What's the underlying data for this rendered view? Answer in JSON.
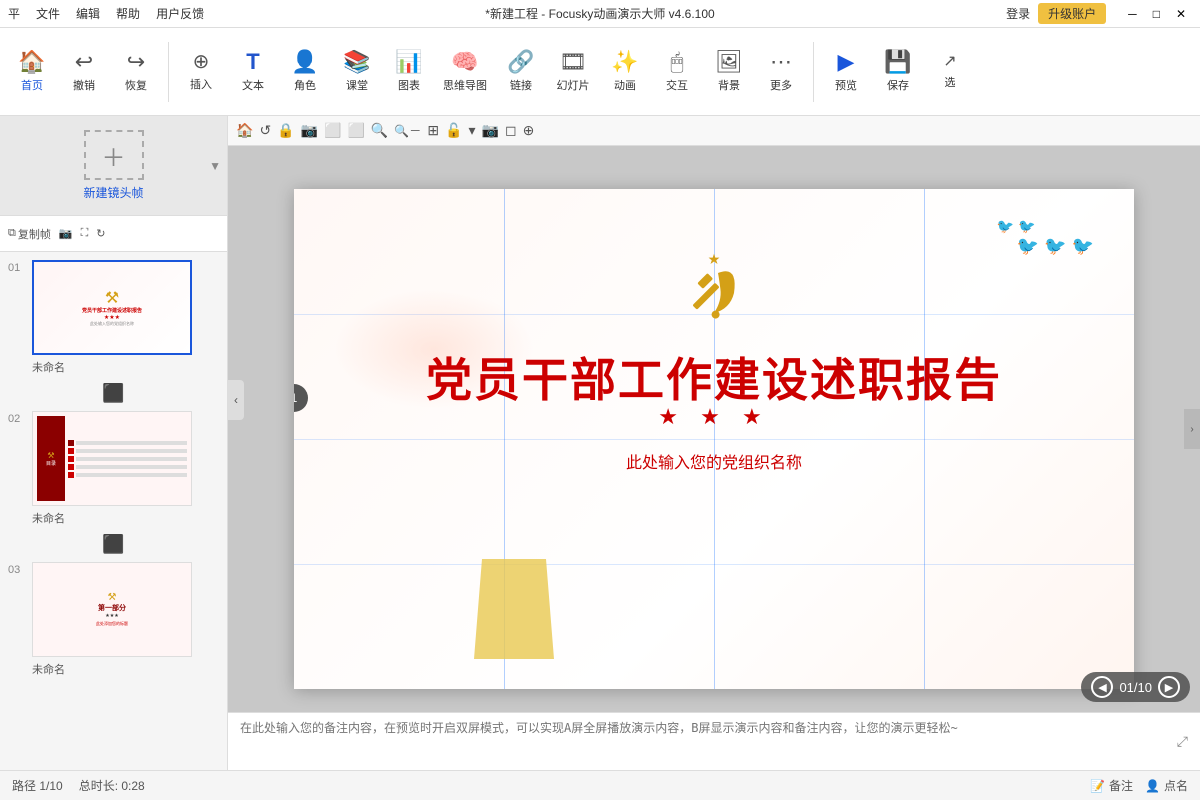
{
  "titlebar": {
    "menu": [
      "平",
      "文件",
      "编辑",
      "帮助",
      "用户反馈"
    ],
    "title": "*新建工程 - Focusky动画演示大师  v4.6.100",
    "login": "登录",
    "upgrade": "升级账户",
    "win_min": "─",
    "win_max": "□",
    "win_close": "✕"
  },
  "toolbar": {
    "items": [
      {
        "label": "首页",
        "icon": "🏠"
      },
      {
        "label": "撤销",
        "icon": "↩"
      },
      {
        "label": "恢复",
        "icon": "↪"
      },
      {
        "label": "插入",
        "icon": "➕"
      },
      {
        "label": "文本",
        "icon": "T"
      },
      {
        "label": "角色",
        "icon": "👤"
      },
      {
        "label": "课堂",
        "icon": "🎓"
      },
      {
        "label": "图表",
        "icon": "📊"
      },
      {
        "label": "思维导图",
        "icon": "🧠"
      },
      {
        "label": "链接",
        "icon": "🔗"
      },
      {
        "label": "幻灯片",
        "icon": "🎞"
      },
      {
        "label": "动画",
        "icon": "✨"
      },
      {
        "label": "交互",
        "icon": "🖱"
      },
      {
        "label": "背景",
        "icon": "🖼"
      },
      {
        "label": "更多",
        "icon": "⋯"
      },
      {
        "label": "预览",
        "icon": "▶"
      },
      {
        "label": "保存",
        "icon": "💾"
      },
      {
        "label": "选",
        "icon": "↗"
      }
    ]
  },
  "slides": [
    {
      "number": "01",
      "name": "未命名",
      "active": true
    },
    {
      "number": "02",
      "name": "未命名",
      "active": false
    },
    {
      "number": "03",
      "name": "未命名",
      "active": false
    }
  ],
  "new_frame_label": "新建镜头帧",
  "frame_tools": {
    "copy": "复制帧",
    "camera_icon": "📷",
    "expand_icon": "⛶",
    "refresh_icon": "↻"
  },
  "canvas": {
    "party_emblem": "☭",
    "main_title": "党员干部工作建设述职报告",
    "stars": "★ ★ ★",
    "subtitle": "此处输入您的党组织名称",
    "frame_number": "1",
    "counter": "01/10"
  },
  "notes": {
    "placeholder": "在此处输入您的备注内容，在预览时开启双屏模式，可以实现A屏全屏播放演示内容，B屏显示演示内容和备注内容，让您的演示更轻松~"
  },
  "statusbar": {
    "path": "路径 1/10",
    "duration": "总时长: 0:28",
    "notes_label": "备注",
    "points_label": "点名"
  },
  "canvas_tools": [
    "🏠",
    "↺",
    "🔒",
    "📷",
    "⬜",
    "⬜",
    "🔍+",
    "🔍-",
    "⊞",
    "🔒",
    "▾",
    "📷",
    "⬜",
    "⊕"
  ]
}
